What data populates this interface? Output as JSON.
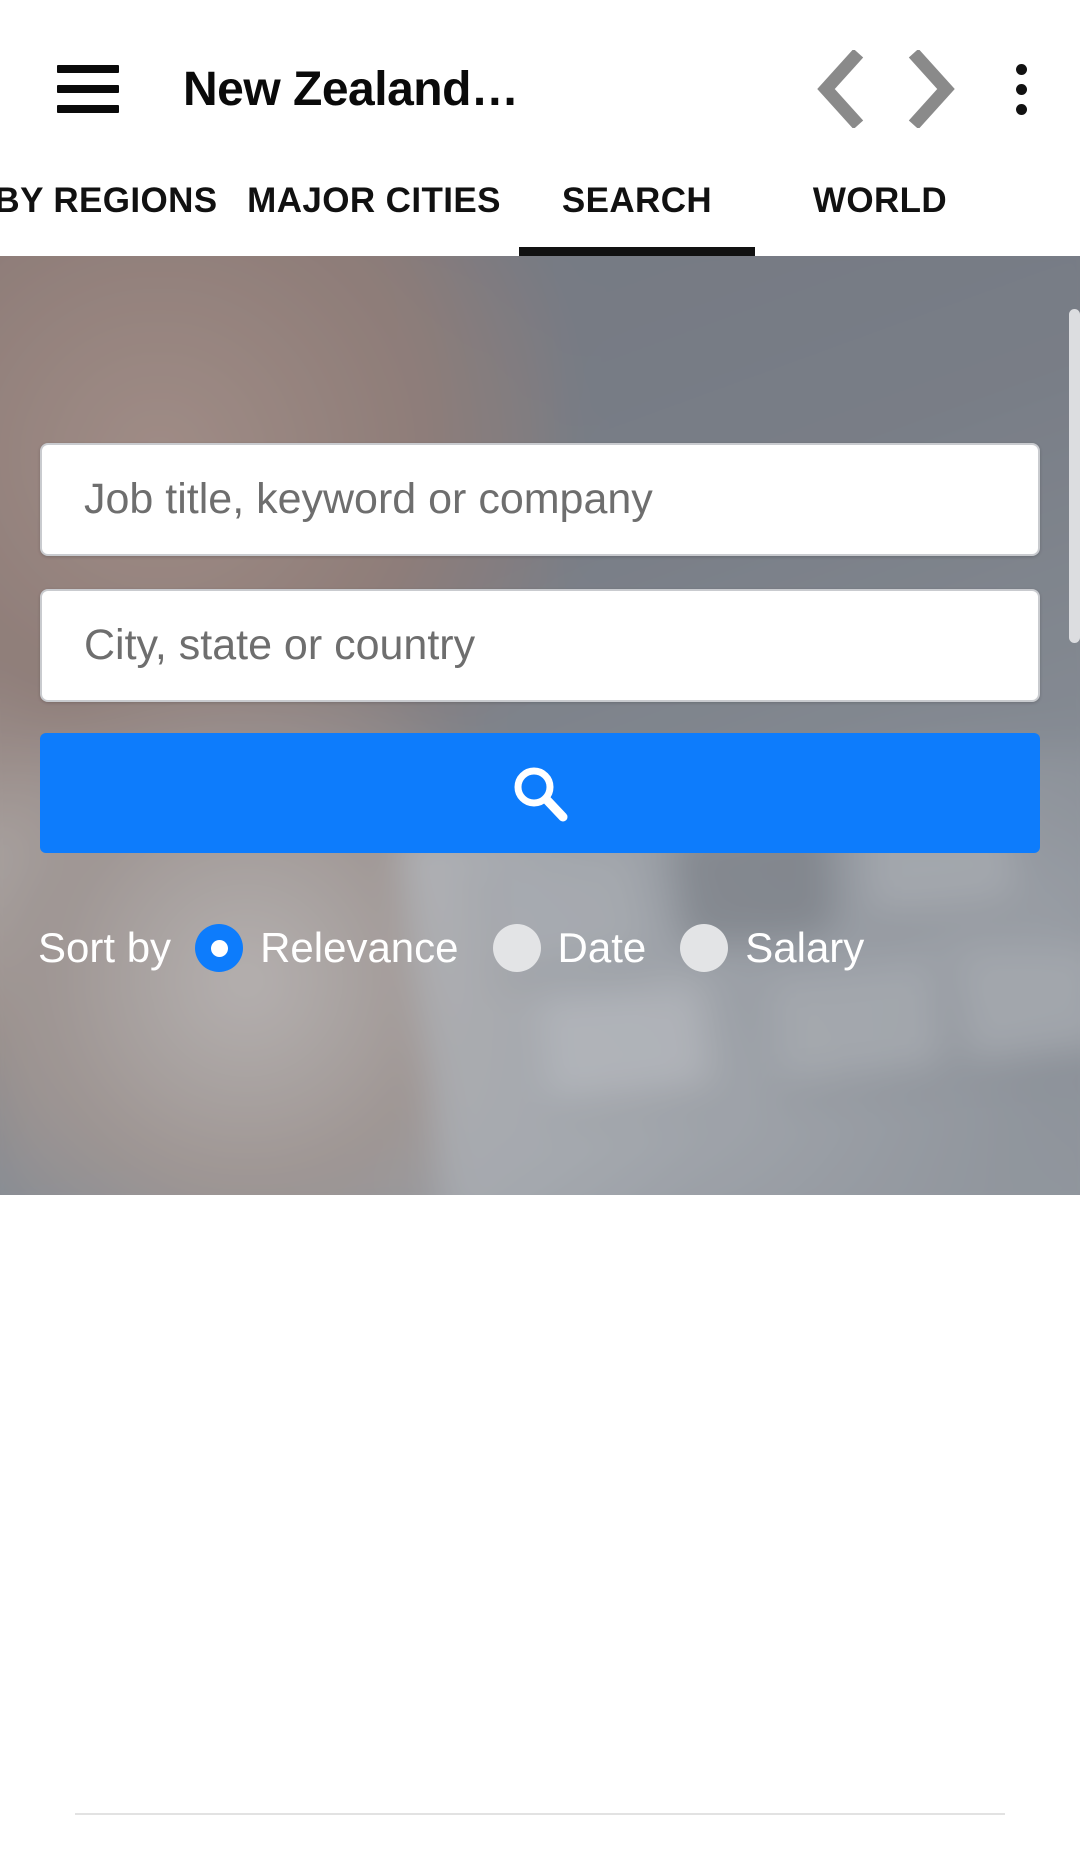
{
  "appbar": {
    "menu_icon": "hamburger-menu-icon",
    "title": "New Zealand…",
    "back_icon": "chevron-left-icon",
    "forward_icon": "chevron-right-icon",
    "overflow_icon": "more-vertical-icon"
  },
  "tabs": {
    "items": [
      {
        "label": "BY REGIONS",
        "active": false
      },
      {
        "label": "MAJOR CITIES",
        "active": false
      },
      {
        "label": "SEARCH",
        "active": true
      },
      {
        "label": "WORLD",
        "active": false
      }
    ]
  },
  "search": {
    "keyword_placeholder": "Job title, keyword or company",
    "keyword_value": "",
    "location_placeholder": "City, state or country",
    "location_value": "",
    "submit_icon": "search-icon",
    "submit_color": "#0d7cfc"
  },
  "sort": {
    "label": "Sort by",
    "options": [
      {
        "label": "Relevance",
        "selected": true
      },
      {
        "label": "Date",
        "selected": false
      },
      {
        "label": "Salary",
        "selected": false
      }
    ],
    "selected_color": "#0d7cfc",
    "unselected_color": "#e3e4e6"
  },
  "colors": {
    "accent": "#0d7cfc",
    "appbar_bg": "#ffffff",
    "text": "#111111",
    "placeholder": "#6e6e6e",
    "hero_overlay": "rgba(95,99,108,0.34)"
  }
}
